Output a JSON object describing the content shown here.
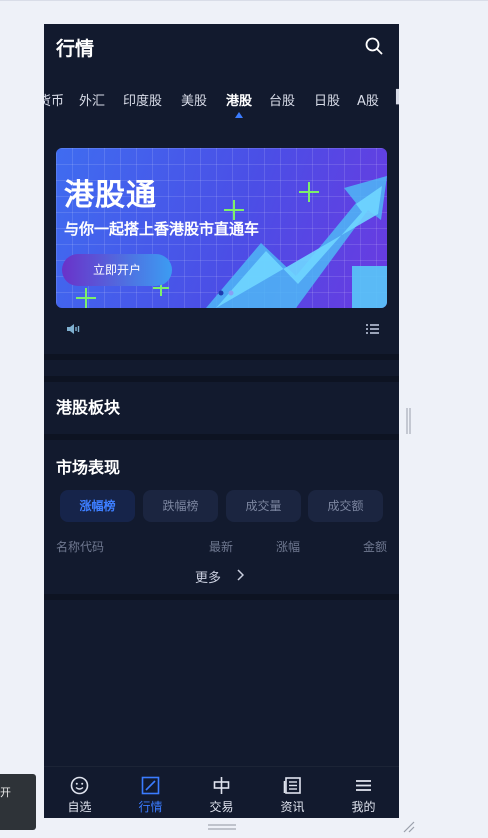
{
  "header": {
    "title": "行情"
  },
  "tabs": [
    {
      "label": "货币",
      "active": false
    },
    {
      "label": "外汇",
      "active": false
    },
    {
      "label": "印度股",
      "active": false
    },
    {
      "label": "美股",
      "active": false
    },
    {
      "label": "港股",
      "active": true
    },
    {
      "label": "台股",
      "active": false
    },
    {
      "label": "日股",
      "active": false
    },
    {
      "label": "A股",
      "active": false
    }
  ],
  "banner": {
    "title": "港股通",
    "subtitle": "与你一起搭上香港股市直通车",
    "cta": "立即开户"
  },
  "sections": {
    "sector_title": "港股板块",
    "market_title": "市场表现"
  },
  "market": {
    "filters": [
      {
        "label": "涨幅榜",
        "active": true
      },
      {
        "label": "跌幅榜",
        "active": false
      },
      {
        "label": "成交量",
        "active": false
      },
      {
        "label": "成交额",
        "active": false
      }
    ],
    "columns": [
      "名称代码",
      "最新",
      "涨幅",
      "金额"
    ],
    "more": "更多"
  },
  "bottom_nav": [
    {
      "label": "自选",
      "icon": "smiley-icon",
      "active": false
    },
    {
      "label": "行情",
      "icon": "chart-square-icon",
      "active": true
    },
    {
      "label": "交易",
      "icon": "trade-icon",
      "active": false
    },
    {
      "label": "资讯",
      "icon": "news-icon",
      "active": false
    },
    {
      "label": "我的",
      "icon": "menu-icon",
      "active": false
    }
  ],
  "toast": {
    "text": "开"
  },
  "colors": {
    "app_bg": "#121a2e",
    "accent": "#3b7cff",
    "page_bg": "#eef1f8"
  }
}
